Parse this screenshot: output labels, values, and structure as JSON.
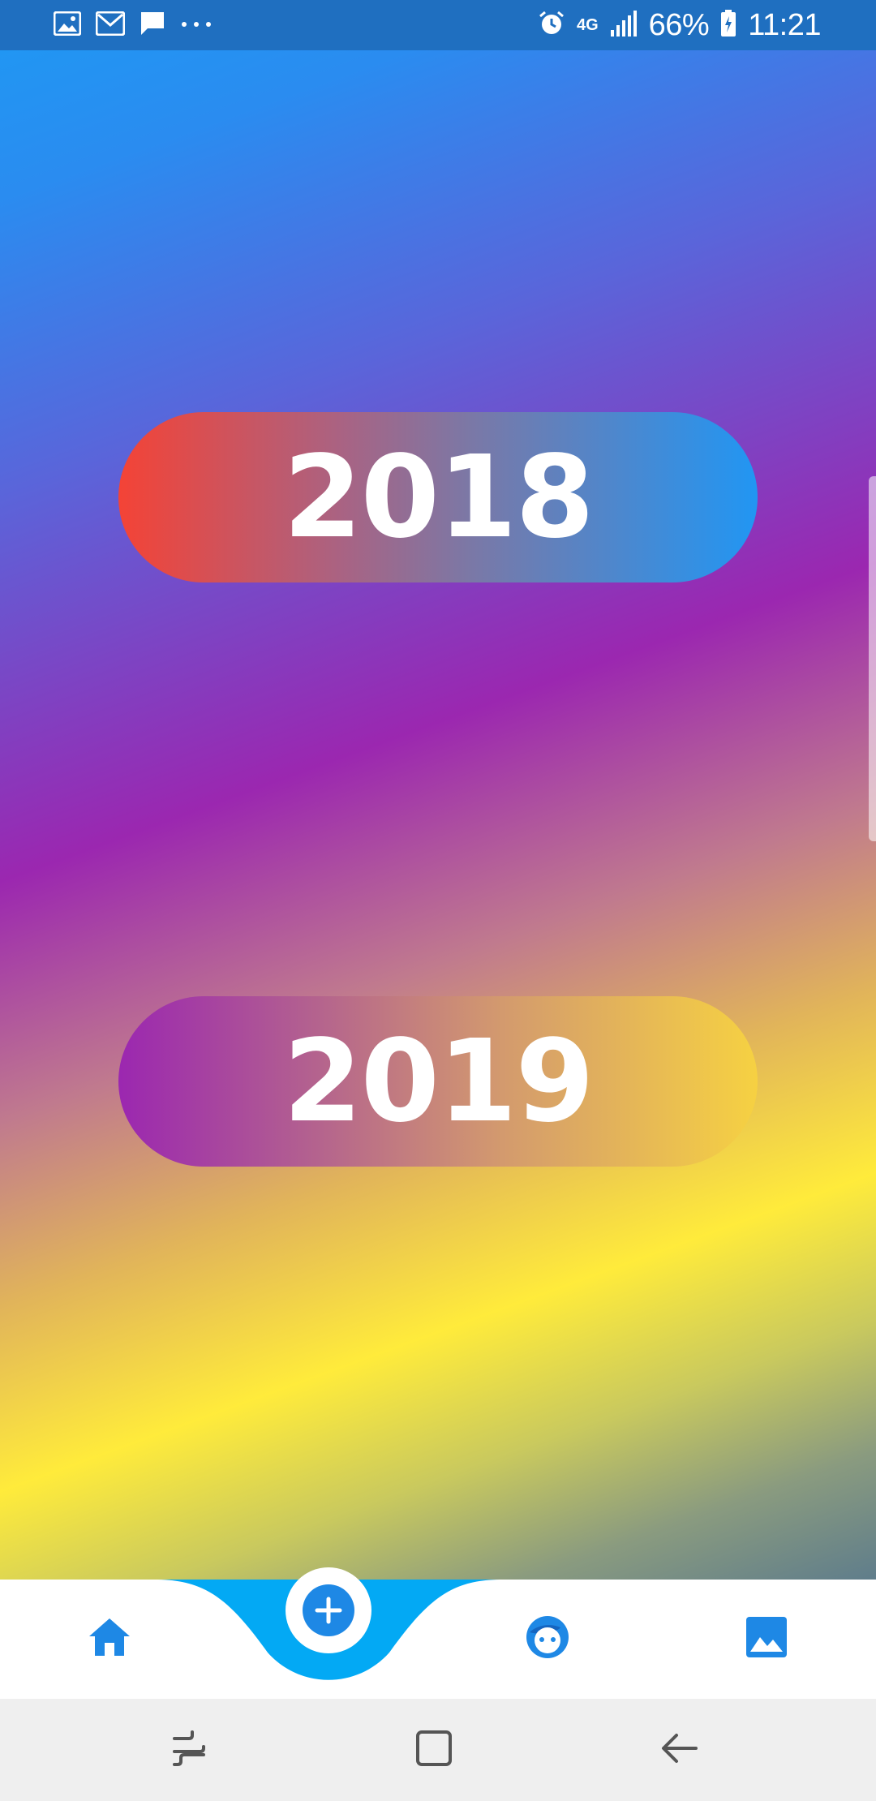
{
  "status_bar": {
    "network": "4G",
    "battery_percent": "66%",
    "time": "11:21",
    "left_icons": [
      "gallery-icon",
      "gmail-icon",
      "message-icon",
      "more-dots-icon"
    ],
    "right_icons": [
      "alarm-icon",
      "signal-icon",
      "battery-icon"
    ]
  },
  "years": {
    "first": "2018",
    "second": "2019"
  },
  "colors": {
    "accent": "#1e88e5",
    "nav_curve": "#03a9f4",
    "gradient_top": "#2196f3",
    "gradient_mid": "#9b27b0",
    "gradient_low": "#ffeb3b",
    "pill_2018_start": "#f44336",
    "pill_2019_end": "#f6d142"
  },
  "bottom_nav": {
    "items": [
      "home-icon",
      "add-icon",
      "face-icon",
      "image-icon"
    ]
  },
  "system_nav": {
    "buttons": [
      "recent-apps-icon",
      "home-square-icon",
      "back-icon"
    ]
  }
}
